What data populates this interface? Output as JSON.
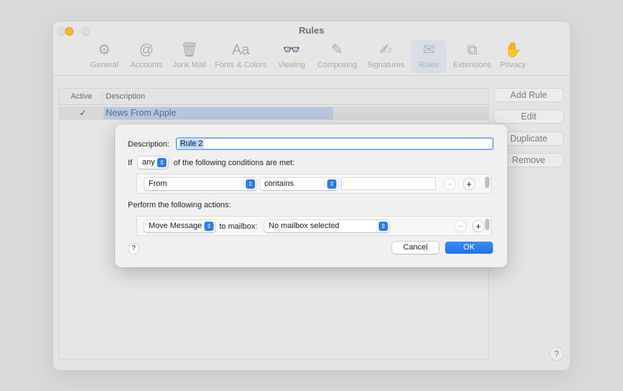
{
  "window": {
    "title": "Rules"
  },
  "toolbar": {
    "items": [
      {
        "label": "General",
        "icon": "gear-icon",
        "glyph": "⚙"
      },
      {
        "label": "Accounts",
        "icon": "at-icon",
        "glyph": "@"
      },
      {
        "label": "Junk Mail",
        "icon": "junk-mail-icon",
        "glyph": "🗑"
      },
      {
        "label": "Fonts & Colors",
        "icon": "fonts-icon",
        "glyph": "Aa"
      },
      {
        "label": "Viewing",
        "icon": "glasses-icon",
        "glyph": "👓"
      },
      {
        "label": "Composing",
        "icon": "compose-icon",
        "glyph": "✎"
      },
      {
        "label": "Signatures",
        "icon": "signature-icon",
        "glyph": "✍"
      },
      {
        "label": "Rules",
        "icon": "rules-envelope-icon",
        "glyph": "✉"
      },
      {
        "label": "Extensions",
        "icon": "extensions-icon",
        "glyph": "⧉"
      },
      {
        "label": "Privacy",
        "icon": "hand-icon",
        "glyph": "✋"
      }
    ],
    "selected": "Rules"
  },
  "rules_list": {
    "columns": {
      "active": "Active",
      "description": "Description"
    },
    "rows": [
      {
        "active": "✓",
        "description": "News From Apple"
      }
    ]
  },
  "side_buttons": {
    "add": "Add Rule",
    "edit": "Edit",
    "duplicate": "Duplicate",
    "remove": "Remove"
  },
  "help_glyph": "?",
  "sheet": {
    "description_label": "Description:",
    "description_value": "Rule 2",
    "if_label": "If",
    "match_value": "any",
    "conditions_suffix": "of the following conditions are met:",
    "condition": {
      "field": "From",
      "operator": "contains",
      "value": ""
    },
    "perform_label": "Perform the following actions:",
    "action": {
      "type": "Move Message",
      "to_label": "to mailbox:",
      "mailbox": "No mailbox selected"
    },
    "minus_glyph": "−",
    "plus_glyph": "+",
    "stepper_glyph": "⇕",
    "cancel_label": "Cancel",
    "ok_label": "OK"
  },
  "colors": {
    "accent": "#2a7ef4",
    "selection": "#b9c8df",
    "traffic_yellow": "#f5b72d"
  }
}
